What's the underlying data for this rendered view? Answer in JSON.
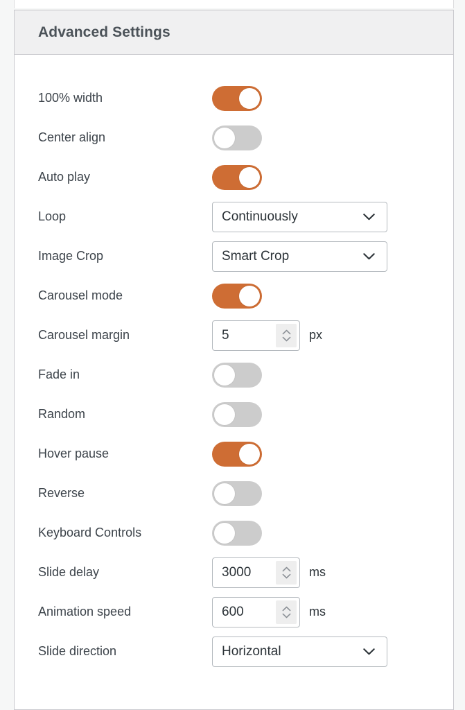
{
  "colors": {
    "accent_on": "#ce6d34",
    "toggle_off": "#cccccc",
    "panel_bg": "#ffffff",
    "header_bg": "#f0f0f1",
    "page_bg": "#f6f7f7",
    "border": "#c9c9ce",
    "label_text": "#3c434a",
    "title_text": "#4b5258"
  },
  "panel": {
    "header": {
      "title": "Advanced Settings"
    },
    "rows": [
      {
        "id": "full-width",
        "label": "100% width",
        "control": "toggle",
        "state": "on"
      },
      {
        "id": "center-align",
        "label": "Center align",
        "control": "toggle",
        "state": "off"
      },
      {
        "id": "auto-play",
        "label": "Auto play",
        "control": "toggle",
        "state": "on"
      },
      {
        "id": "loop",
        "label": "Loop",
        "control": "select",
        "value": "Continuously"
      },
      {
        "id": "image-crop",
        "label": "Image Crop",
        "control": "select",
        "value": "Smart Crop"
      },
      {
        "id": "carousel-mode",
        "label": "Carousel mode",
        "control": "toggle",
        "state": "on"
      },
      {
        "id": "carousel-margin",
        "label": "Carousel margin",
        "control": "number",
        "value": "5",
        "unit": "px"
      },
      {
        "id": "fade-in",
        "label": "Fade in",
        "control": "toggle",
        "state": "off"
      },
      {
        "id": "random",
        "label": "Random",
        "control": "toggle",
        "state": "off"
      },
      {
        "id": "hover-pause",
        "label": "Hover pause",
        "control": "toggle",
        "state": "on"
      },
      {
        "id": "reverse",
        "label": "Reverse",
        "control": "toggle",
        "state": "off"
      },
      {
        "id": "keyboard-controls",
        "label": "Keyboard Controls",
        "control": "toggle",
        "state": "off"
      },
      {
        "id": "slide-delay",
        "label": "Slide delay",
        "control": "number",
        "value": "3000",
        "unit": "ms"
      },
      {
        "id": "animation-speed",
        "label": "Animation speed",
        "control": "number",
        "value": "600",
        "unit": "ms"
      },
      {
        "id": "slide-direction",
        "label": "Slide direction",
        "control": "select",
        "value": "Horizontal"
      }
    ]
  },
  "icons": {
    "chevron_down": "chevron-down-icon",
    "spinner_up": "spinner-up-icon",
    "spinner_down": "spinner-down-icon"
  }
}
